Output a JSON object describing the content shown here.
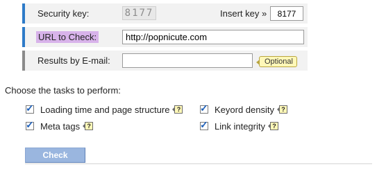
{
  "form": {
    "security": {
      "label": "Security key:",
      "captcha_value": "8177",
      "insert_label": "Insert key »",
      "insert_value": "8177"
    },
    "url": {
      "label": "URL to Check:",
      "value": "http://popnicute.com"
    },
    "email": {
      "label": "Results by E-mail:",
      "value": "",
      "optional_badge": "Optional"
    }
  },
  "tasks": {
    "heading": "Choose the tasks to perform:",
    "items": [
      {
        "label": "Loading time and page structure",
        "checked": true,
        "help": "?"
      },
      {
        "label": "Keyord density",
        "checked": true,
        "help": "?"
      },
      {
        "label": "Meta tags",
        "checked": true,
        "help": "?"
      },
      {
        "label": "Link integrity",
        "checked": true,
        "help": "?"
      }
    ]
  },
  "actions": {
    "check_label": "Check"
  },
  "colors": {
    "row_accent": "#2e7bc8",
    "label_highlight": "#d8b3ea",
    "tooltip_bg": "#fff8b8",
    "button_bg": "#9ab6df"
  }
}
